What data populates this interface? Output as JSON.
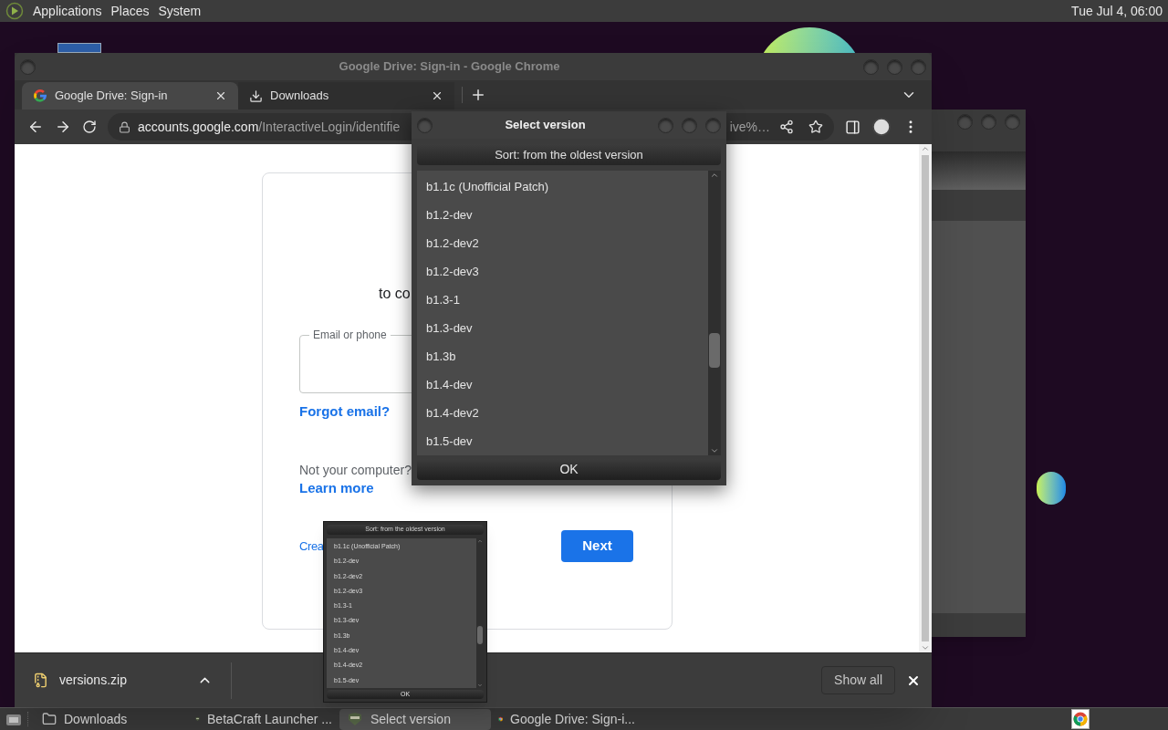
{
  "top_panel": {
    "menus": [
      "Applications",
      "Places",
      "System"
    ],
    "clock": "Tue Jul  4, 06:00"
  },
  "browser": {
    "title": "Google Drive: Sign-in - Google Chrome",
    "tabs": [
      {
        "label": "Google Drive: Sign-in",
        "kind": "page",
        "selected": true
      },
      {
        "label": "Downloads",
        "kind": "downloads",
        "selected": false
      }
    ],
    "address": {
      "host": "accounts.google.com",
      "path": "/InteractiveLogin/identifie",
      "tail": "ive%…"
    },
    "page": {
      "subtitle": "to co",
      "email_label": "Email or phone",
      "forgot": "Forgot email?",
      "note": "Not your computer?",
      "learn_more": "Learn more",
      "create": "Crea",
      "next": "Next"
    },
    "download_shelf": {
      "file": "versions.zip",
      "show_all": "Show all"
    }
  },
  "dialog": {
    "title": "Select version",
    "sort_button": "Sort: from the oldest version",
    "versions": [
      "b1.1c (Unofficial Patch)",
      "b1.2-dev",
      "b1.2-dev2",
      "b1.2-dev3",
      "b1.3-1",
      "b1.3-dev",
      "b1.3b",
      "b1.4-dev",
      "b1.4-dev2",
      "b1.5-dev"
    ],
    "ok": "OK"
  },
  "preview": {
    "sort_button": "Sort: from the oldest version",
    "versions": [
      "b1.1c (Unofficial Patch)",
      "b1.2-dev",
      "b1.2-dev2",
      "b1.2-dev3",
      "b1.3-1",
      "b1.3-dev",
      "b1.3b",
      "b1.4-dev",
      "b1.4-dev2",
      "b1.5-dev"
    ],
    "ok": "OK"
  },
  "taskbar": {
    "items": [
      {
        "label": "Downloads",
        "kind": "folder",
        "selected": false
      },
      {
        "label": "BetaCraft Launcher ...",
        "kind": "game",
        "selected": false
      },
      {
        "label": "Select version",
        "kind": "game",
        "selected": true
      },
      {
        "label": "Google Drive: Sign-i...",
        "kind": "browser",
        "selected": false
      }
    ]
  }
}
